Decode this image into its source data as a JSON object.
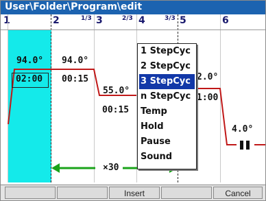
{
  "window": {
    "title": "User\\Folder\\Program\\edit"
  },
  "columns": [
    {
      "num": "1",
      "frac": ""
    },
    {
      "num": "2",
      "frac": "1/3"
    },
    {
      "num": "3",
      "frac": "2/3"
    },
    {
      "num": "4",
      "frac": "3/3"
    },
    {
      "num": "5",
      "frac": ""
    },
    {
      "num": "6",
      "frac": ""
    }
  ],
  "steps": {
    "s1_temp": "94.0°",
    "s1_time": "02:00",
    "s2_temp": "94.0°",
    "s2_time": "00:15",
    "s3_temp": "55.0°",
    "s3_time": "00:15",
    "s5_temp_partial": "2.0°",
    "s5_time_partial": "1:00",
    "s6_temp": "4.0°"
  },
  "cycle": {
    "label": "×30"
  },
  "menu": {
    "items": [
      "1 StepCyc",
      "2 StepCyc",
      "3 StepCyc",
      "n StepCyc",
      "Temp",
      "Hold",
      "Pause",
      "Sound"
    ],
    "selected_index": 2
  },
  "toolbar": {
    "buttons": [
      "",
      "",
      "Insert",
      "",
      "Cancel"
    ]
  },
  "colors": {
    "title_bar": "#1c63b0",
    "active_stage": "#14eaea",
    "profile_line": "#c01818",
    "cycle_arrow": "#1aa31a",
    "menu_selection": "#1238a8"
  }
}
